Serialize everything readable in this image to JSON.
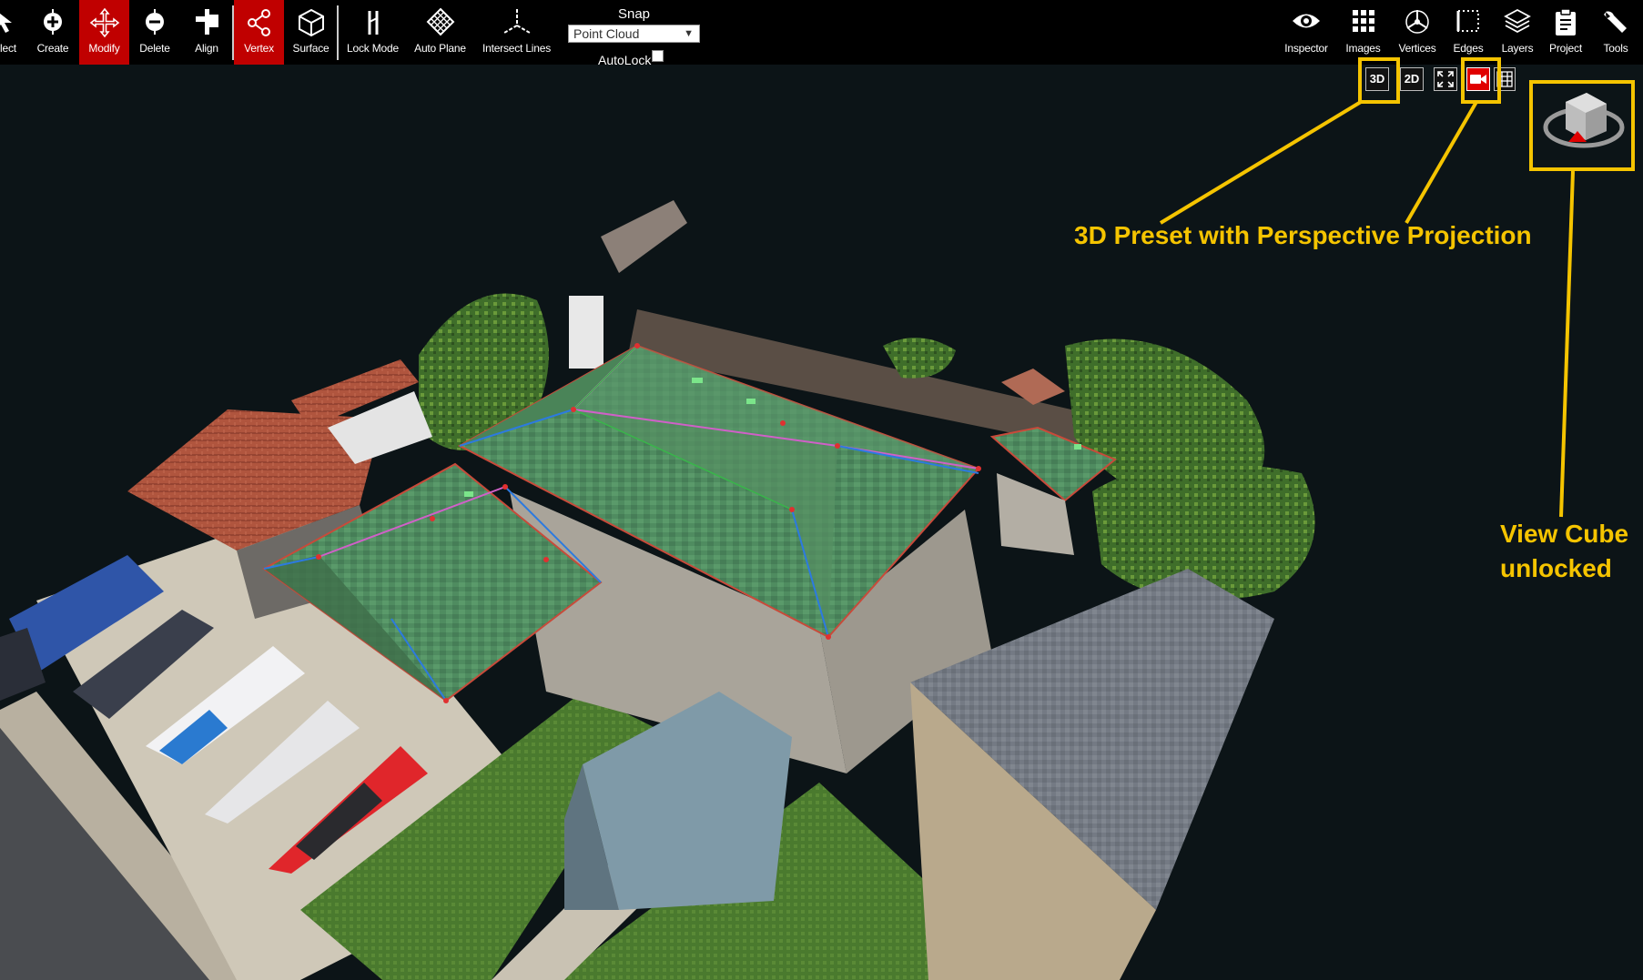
{
  "toolbar": {
    "tools": [
      {
        "label": "lect",
        "icon": "select-arrow-icon",
        "active": false
      },
      {
        "label": "Create",
        "icon": "create-plus-icon",
        "active": false
      },
      {
        "label": "Modify",
        "icon": "modify-move-icon",
        "active": true
      },
      {
        "label": "Delete",
        "icon": "delete-minus-icon",
        "active": false
      },
      {
        "label": "Align",
        "icon": "align-icon",
        "active": false
      },
      {
        "label": "Vertex",
        "icon": "vertex-share-icon",
        "active": true
      },
      {
        "label": "Surface",
        "icon": "surface-cube-icon",
        "active": false
      },
      {
        "label": "Lock Mode",
        "icon": "lock-mode-icon",
        "active": false
      },
      {
        "label": "Auto Plane",
        "icon": "auto-plane-icon",
        "active": false
      },
      {
        "label": "Intersect Lines",
        "icon": "intersect-lines-icon",
        "active": false
      }
    ],
    "snap": {
      "label": "Snap",
      "value": "Point Cloud"
    },
    "autolock": {
      "label": "AutoLock",
      "checked": false
    },
    "panels": [
      {
        "label": "Inspector",
        "icon": "eye-icon"
      },
      {
        "label": "Images",
        "icon": "grid-icon"
      },
      {
        "label": "Vertices",
        "icon": "vertices-icon"
      },
      {
        "label": "Edges",
        "icon": "edges-icon"
      },
      {
        "label": "Layers",
        "icon": "layers-icon"
      },
      {
        "label": "Project",
        "icon": "clipboard-icon"
      },
      {
        "label": "Tools",
        "icon": "wrench-icon"
      }
    ]
  },
  "view_controls": {
    "btn_3d": "3D",
    "btn_2d": "2D",
    "fullscreen_icon": "fullscreen-icon",
    "camera_icon": "video-camera-icon",
    "grid_icon": "grid-table-icon"
  },
  "annotations": {
    "preset": "3D Preset with Perspective Projection",
    "cube_line1": "View Cube",
    "cube_line2": "unlocked",
    "color": "#f5c400"
  },
  "colors": {
    "accent": "#c00000",
    "toolbar_bg": "#000000",
    "viewport_bg": "#0c1417",
    "roof_green": "#4e8a5e",
    "roof_red": "#b4583e",
    "roof_gray": "#7a7f88"
  }
}
